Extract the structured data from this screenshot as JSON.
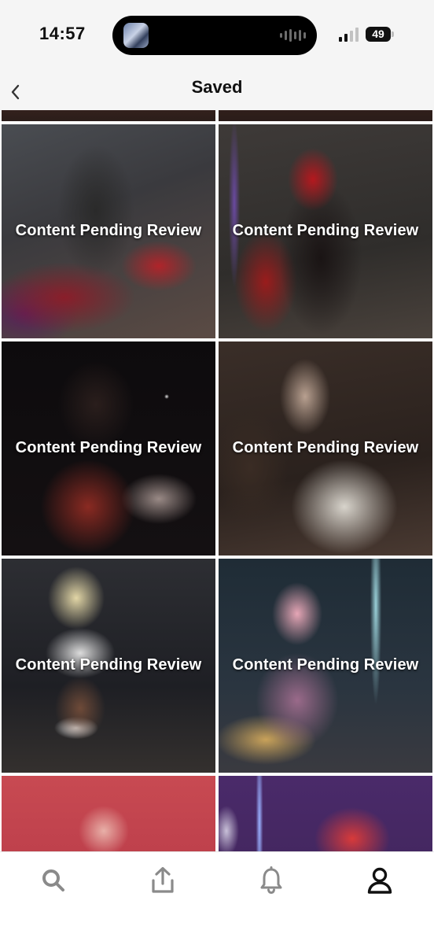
{
  "status_bar": {
    "time": "14:57",
    "battery": "49",
    "icons": [
      "app-thumbnail-icon",
      "audio-wave-icon",
      "signal-icon",
      "battery-icon"
    ]
  },
  "nav": {
    "title": "Saved",
    "back_icon": "chevron-left-icon"
  },
  "grid": {
    "items": [
      {
        "label": "",
        "id_hint": "partial-top-left"
      },
      {
        "label": "",
        "id_hint": "partial-top-right"
      },
      {
        "label": "Content Pending Review"
      },
      {
        "label": "Content Pending Review"
      },
      {
        "label": "Content Pending Review"
      },
      {
        "label": "Content Pending Review"
      },
      {
        "label": "Content Pending Review"
      },
      {
        "label": "Content Pending Review"
      },
      {
        "label": ""
      },
      {
        "label": ""
      }
    ]
  },
  "tab_bar": {
    "tabs": [
      {
        "icon": "search-icon",
        "active": false
      },
      {
        "icon": "upload-icon",
        "active": false
      },
      {
        "icon": "bell-icon",
        "active": false
      },
      {
        "icon": "profile-icon",
        "active": true
      }
    ]
  },
  "colors": {
    "active_tab": "#111111",
    "inactive_tab": "#8a8a8a",
    "overlay_text": "#ffffff"
  }
}
